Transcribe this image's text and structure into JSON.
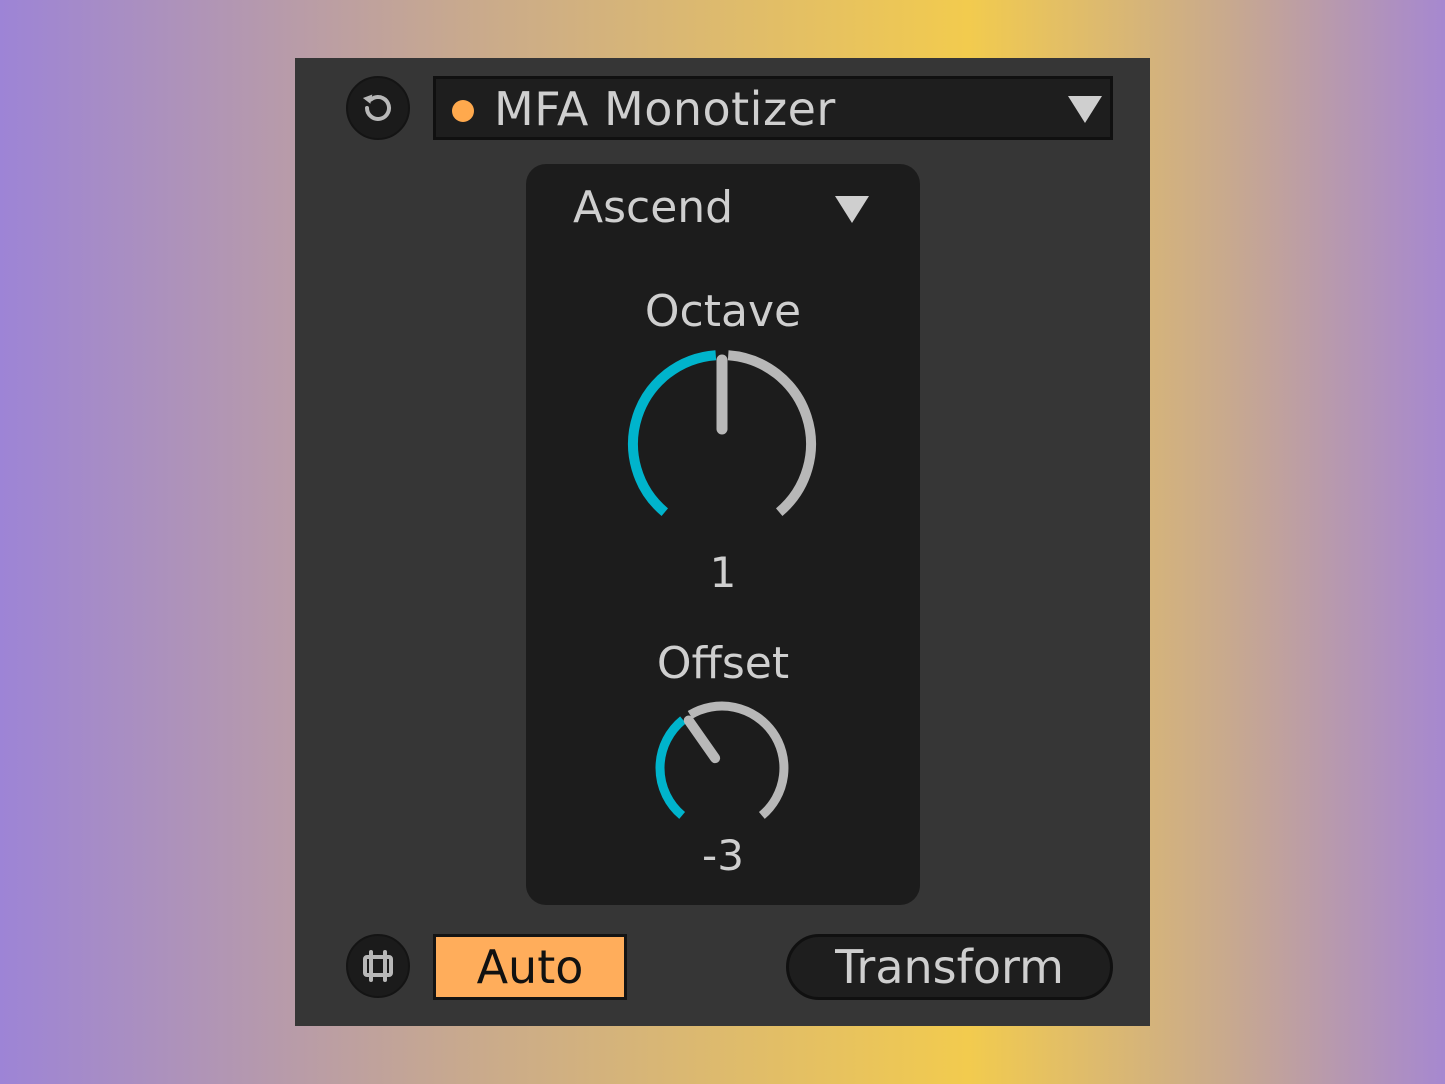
{
  "device": {
    "name": "MFA Monotizer",
    "led_color": "#ffa94d",
    "reset_icon": "reset-icon",
    "clip_icon": "clip-icon"
  },
  "mode": {
    "selected": "Ascend"
  },
  "knobs": {
    "octave": {
      "label": "Octave",
      "value": "1",
      "min": 0,
      "max": 2,
      "fill_fraction": 0.5
    },
    "offset": {
      "label": "Offset",
      "value": "-3",
      "min": -12,
      "max": 12,
      "fill_fraction": 0.375
    }
  },
  "controls": {
    "auto_label": "Auto",
    "transform_label": "Transform"
  },
  "colors": {
    "accent": "#00b4cc",
    "track": "#b8b8b8",
    "auto_active": "#ffad5b",
    "panel": "#1c1c1c",
    "device_bg": "#363636"
  }
}
